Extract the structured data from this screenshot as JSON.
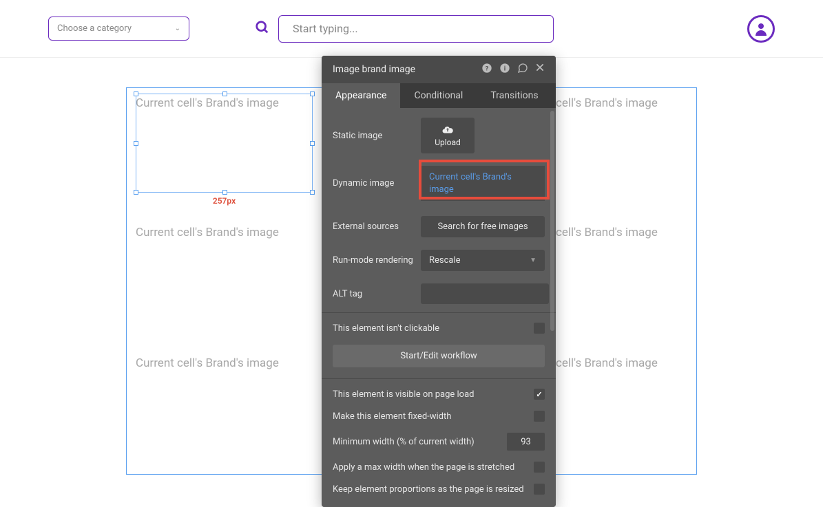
{
  "topbar": {
    "category_placeholder": "Choose a category",
    "search_placeholder": "Start typing..."
  },
  "canvas": {
    "cell_placeholder": "Current cell's Brand's image",
    "selected_width_label": "257px"
  },
  "panel": {
    "title": "Image brand image",
    "tabs": {
      "appearance": "Appearance",
      "conditional": "Conditional",
      "transitions": "Transitions"
    },
    "labels": {
      "static_image": "Static image",
      "upload": "Upload",
      "dynamic_image": "Dynamic image",
      "dynamic_value": "Current cell's Brand's image",
      "external_sources": "External sources",
      "search_free_images": "Search for free images",
      "run_mode": "Run-mode rendering",
      "rescale": "Rescale",
      "alt_tag": "ALT tag",
      "not_clickable": "This element isn't clickable",
      "start_edit_workflow": "Start/Edit workflow",
      "visible_on_load": "This element is visible on page load",
      "fixed_width": "Make this element fixed-width",
      "min_width": "Minimum width (% of current width)",
      "min_width_value": "93",
      "apply_max_width": "Apply a max width when the page is stretched",
      "keep_proportions": "Keep element proportions as the page is resized"
    },
    "checks": {
      "not_clickable": false,
      "visible_on_load": true,
      "fixed_width": false,
      "apply_max_width": false,
      "keep_proportions": false
    }
  }
}
